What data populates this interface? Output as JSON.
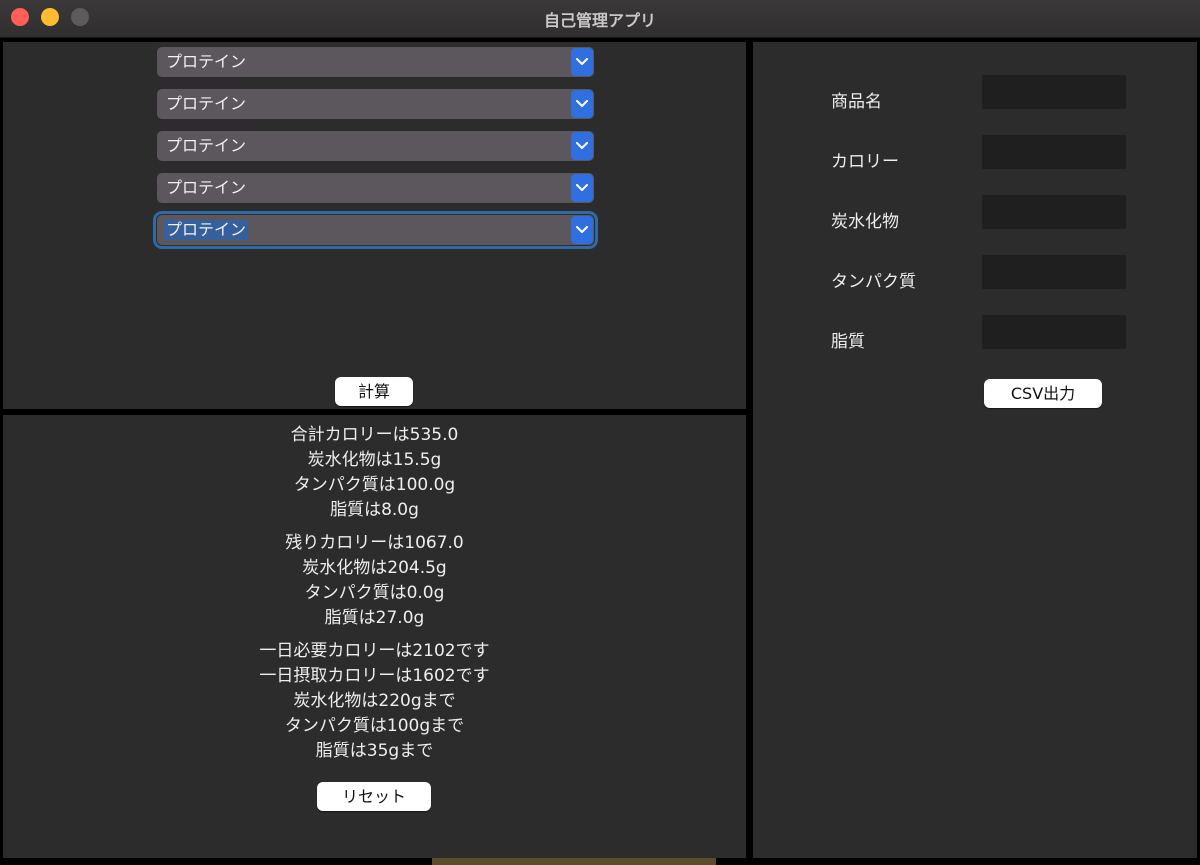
{
  "window": {
    "title": "自己管理アプリ"
  },
  "selects": [
    {
      "value": "プロテイン"
    },
    {
      "value": "プロテイン"
    },
    {
      "value": "プロテイン"
    },
    {
      "value": "プロテイン"
    },
    {
      "value": "プロテイン"
    }
  ],
  "buttons": {
    "calc": "計算",
    "reset": "リセット",
    "csv": "CSV出力"
  },
  "results": {
    "total": [
      "合計カロリーは535.0",
      "炭水化物は15.5g",
      "タンパク質は100.0g",
      "脂質は8.0g"
    ],
    "remaining": [
      "残りカロリーは1067.0",
      "炭水化物は204.5g",
      "タンパク質は0.0g",
      "脂質は27.0g"
    ],
    "daily": [
      "一日必要カロリーは2102です",
      "一日摂取カロリーは1602です",
      "炭水化物は220gまで",
      "タンパク質は100gまで",
      "脂質は35gまで"
    ]
  },
  "form": {
    "fields": [
      {
        "label": "商品名",
        "value": ""
      },
      {
        "label": "カロリー",
        "value": ""
      },
      {
        "label": "炭水化物",
        "value": ""
      },
      {
        "label": "タンパク質",
        "value": ""
      },
      {
        "label": "脂質",
        "value": ""
      }
    ]
  },
  "colors": {
    "accent": "#2f6fe0",
    "panel": "#2c2c2c",
    "dropdown": "#5b575c",
    "input": "#1f1f1f"
  },
  "icons": {
    "dropdown_arrow": "chevron-down-icon"
  }
}
